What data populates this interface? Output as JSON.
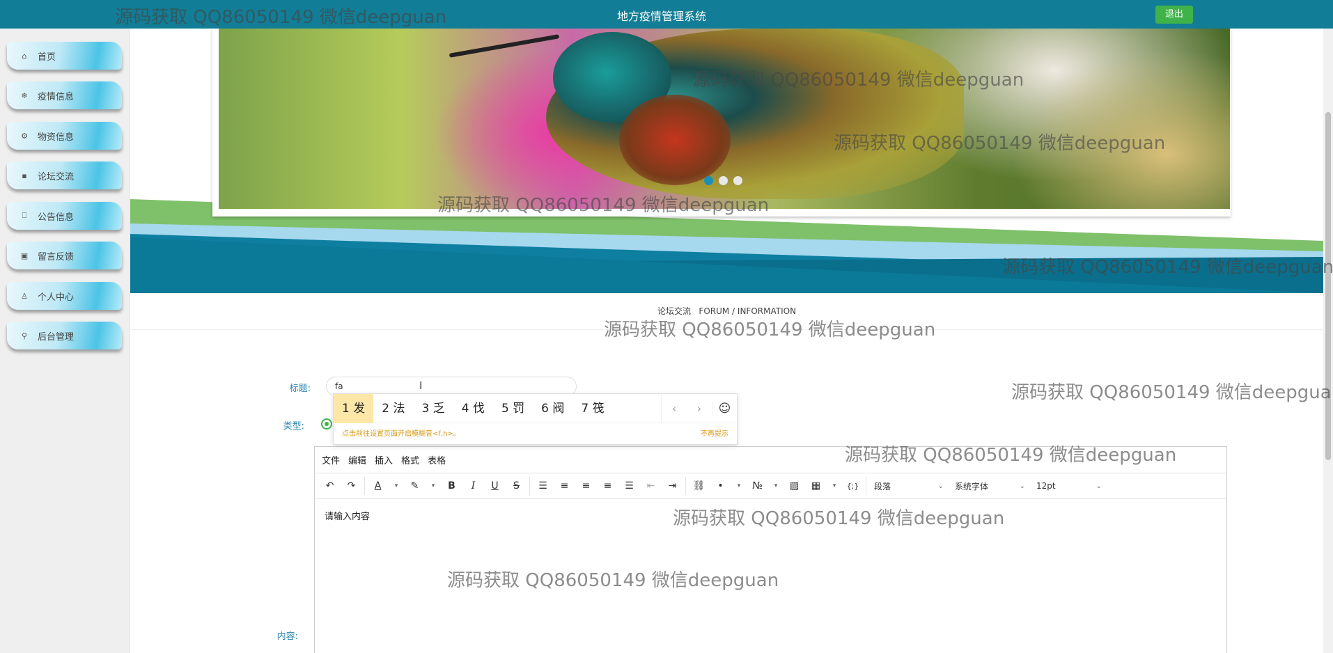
{
  "header": {
    "title": "地方疫情管理系统",
    "logout_label": "退出"
  },
  "sidebar": {
    "items": [
      {
        "label": "首页",
        "icon": "home-icon",
        "glyph": "⌂"
      },
      {
        "label": "疫情信息",
        "icon": "snowflake-icon",
        "glyph": "❄"
      },
      {
        "label": "物资信息",
        "icon": "gear-icon",
        "glyph": "⚙"
      },
      {
        "label": "论坛交流",
        "icon": "forum-icon",
        "glyph": "▪"
      },
      {
        "label": "公告信息",
        "icon": "book-icon",
        "glyph": "⎕"
      },
      {
        "label": "留言反馈",
        "icon": "message-icon",
        "glyph": "▣"
      },
      {
        "label": "个人中心",
        "icon": "user-icon",
        "glyph": "♙"
      },
      {
        "label": "后台管理",
        "icon": "link-icon",
        "glyph": "⚲"
      }
    ],
    "active_index": 3
  },
  "banner": {
    "slide_count": 3,
    "active_slide": 1
  },
  "section": {
    "title": "论坛交流",
    "subtitle": "FORUM / INFORMATION"
  },
  "form": {
    "title_label": "标题:",
    "title_value": "fa",
    "type_label": "类型:",
    "content_label": "内容:"
  },
  "ime": {
    "candidates": [
      "1 发",
      "2 法",
      "3 乏",
      "4 伐",
      "5 罚",
      "6 阀",
      "7 筏"
    ],
    "hint": "点击前往设置页面开启模糊音<f,h>。",
    "dismiss": "不再提示"
  },
  "editor": {
    "menu": [
      "文件",
      "编辑",
      "插入",
      "格式",
      "表格"
    ],
    "block_format": "段落",
    "font_family": "系统字体",
    "font_size": "12pt",
    "placeholder": "请输入内容"
  },
  "watermark": "源码获取 QQ86050149 微信deepguan"
}
